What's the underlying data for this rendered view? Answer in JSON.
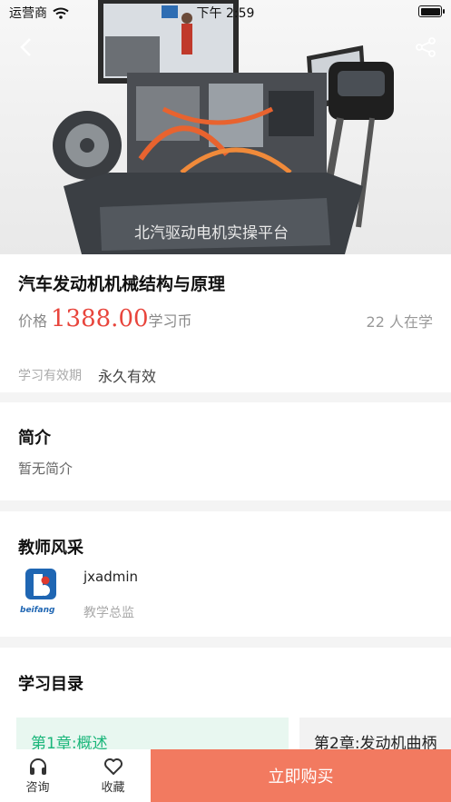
{
  "status_bar": {
    "carrier": "运营商",
    "time": "下午 2:59"
  },
  "course": {
    "title": "汽车发动机机械结构与原理",
    "price_label": "价格",
    "price_value": "1388.00",
    "price_unit": "学习币",
    "learners": "22 人在学",
    "validity_label": "学习有效期",
    "validity_value": "永久有效"
  },
  "hero": {
    "platform_sign": "北汽驱动电机实操平台"
  },
  "intro": {
    "title": "简介",
    "text": "暂无简介"
  },
  "teacher": {
    "title": "教师风采",
    "name": "jxadmin",
    "role": "教学总监",
    "logo_text": "beifang"
  },
  "catalog": {
    "title": "学习目录",
    "chapters": [
      {
        "label": "第1章:概述"
      },
      {
        "label": "第2章:发动机曲柄"
      }
    ]
  },
  "bottom_bar": {
    "consult": "咨询",
    "favorite": "收藏",
    "buy": "立即购买"
  },
  "colors": {
    "price": "#e8453c",
    "buy_button": "#f27a60",
    "active_chapter": "#1ab67a"
  }
}
